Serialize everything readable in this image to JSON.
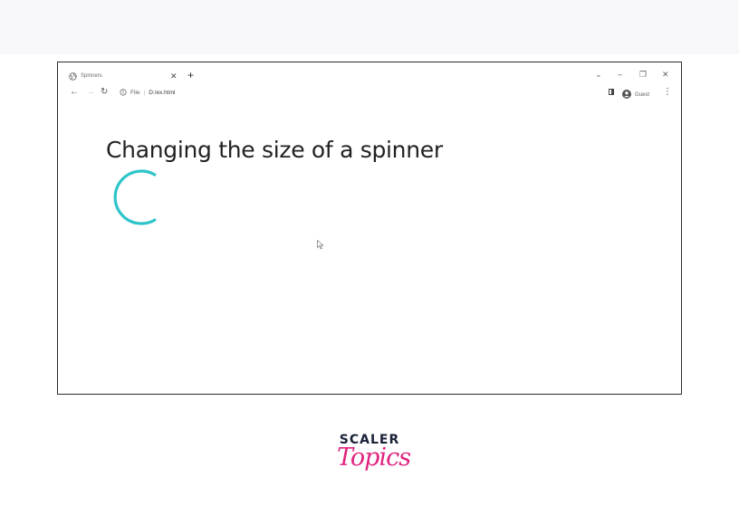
{
  "browser": {
    "tab": {
      "title": "Spinners",
      "close_glyph": "✕",
      "favicon": "globe-icon"
    },
    "new_tab_glyph": "+",
    "window_controls": {
      "tab_search": "⌄",
      "minimize": "–",
      "restore": "❐",
      "close": "✕"
    },
    "nav": {
      "back": "←",
      "forward": "→",
      "reload": "↻"
    },
    "address": {
      "scheme_label": "File",
      "url": "D:/ex.html",
      "icon": "info-icon"
    },
    "profile": {
      "label": "Guest",
      "icon": "account-circle-icon"
    },
    "menu_glyph": "⋮",
    "side_panel_icon": "side-panel-icon"
  },
  "page": {
    "heading": "Changing the size of a spinner",
    "spinner": {
      "color": "#2ec4c9",
      "type": "border"
    }
  },
  "branding": {
    "line1": "SCALER",
    "line2": "Topics",
    "line1_color": "#1a2238",
    "line2_color": "#e0257f"
  },
  "theme": {
    "frame_border": "#2b2b2b",
    "top_band": "#f8f8fb"
  }
}
